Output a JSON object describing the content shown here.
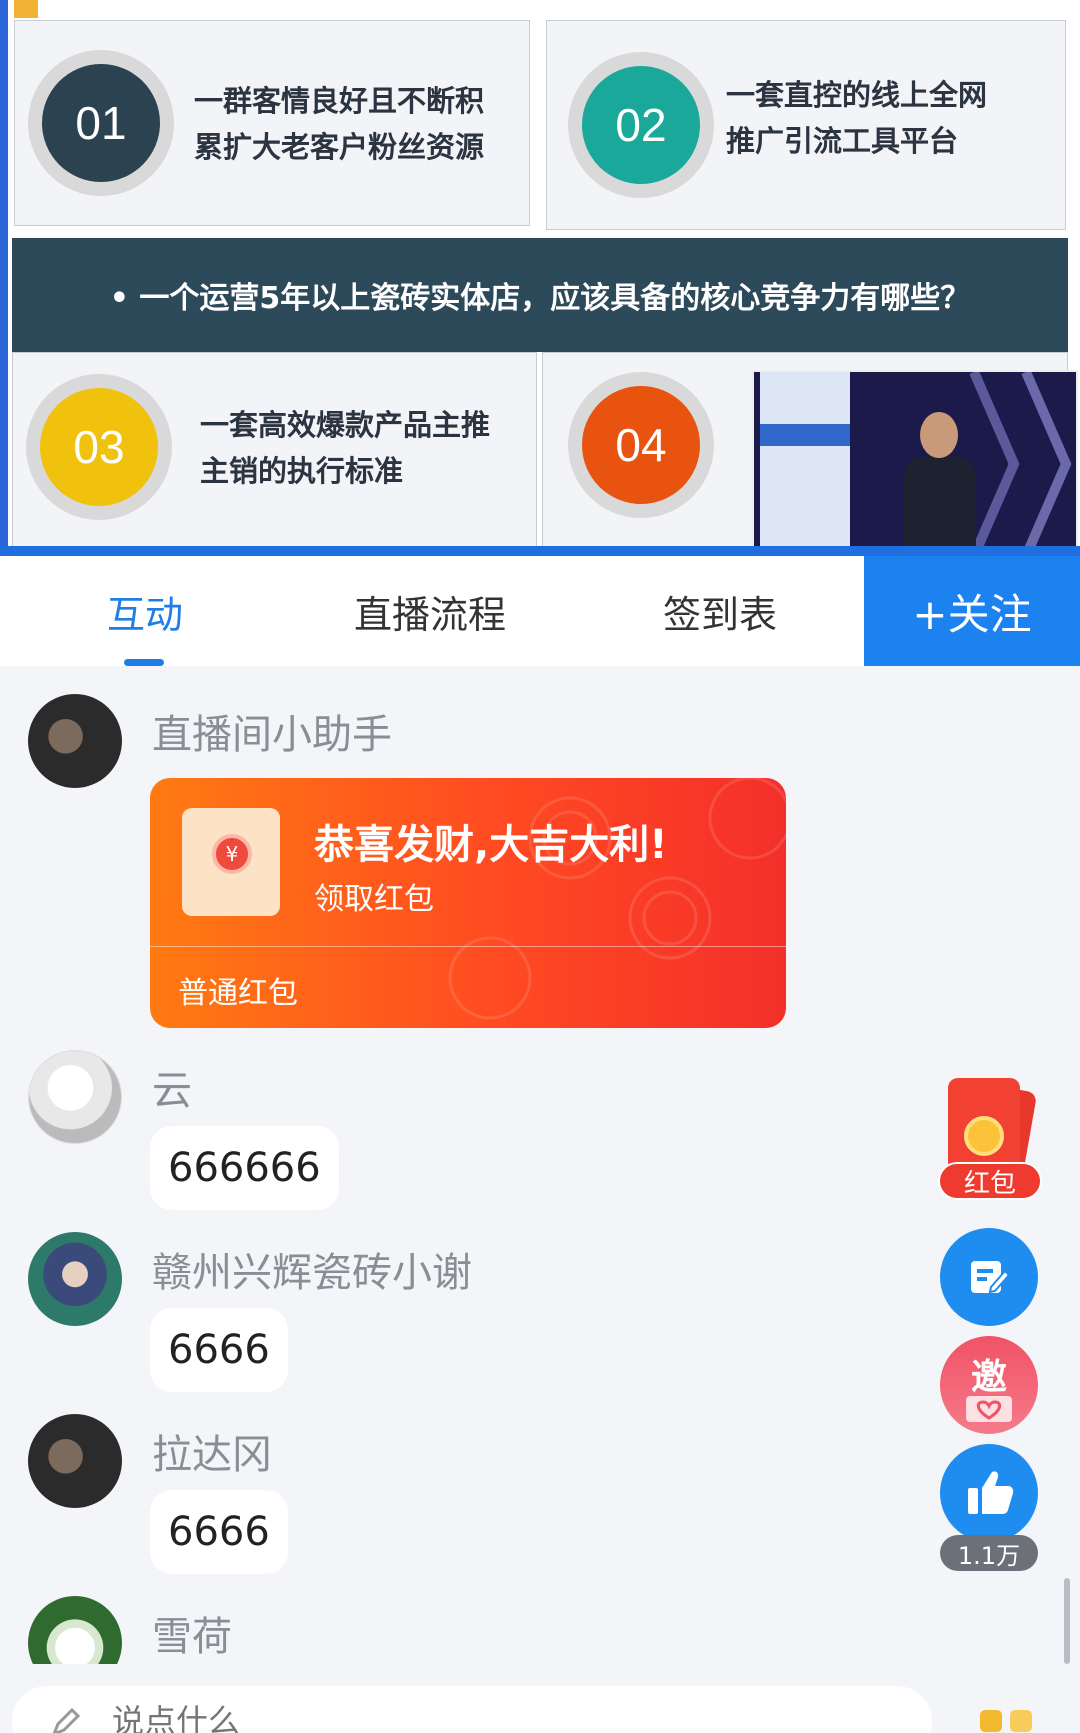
{
  "slide": {
    "cards": [
      {
        "num": "01",
        "line1": "一群客情良好且不断积",
        "line2": "累扩大老客户粉丝资源"
      },
      {
        "num": "02",
        "line1": "一套直控的线上全网",
        "line2": "推广引流工具平台"
      },
      {
        "num": "03",
        "line1": "一套高效爆款产品主推",
        "line2": "主销的执行标准"
      },
      {
        "num": "04"
      }
    ],
    "banner": "• 一个运营5年以上瓷砖实体店，应该具备的核心竞争力有哪些？"
  },
  "tabs": {
    "interact": "互动",
    "flow": "直播流程",
    "signin": "签到表",
    "follow": "+关注"
  },
  "chat": {
    "messages": [
      {
        "user": "直播间小助手"
      },
      {
        "user": "云",
        "text": "666666"
      },
      {
        "user": "赣州兴辉瓷砖小谢",
        "text": "6666"
      },
      {
        "user": "拉达冈",
        "text": "6666"
      },
      {
        "user": "雪荷"
      }
    ],
    "redpacket": {
      "title": "恭喜发财,大吉大利!",
      "action": "领取红包",
      "kind": "普通红包"
    }
  },
  "floating": {
    "redpacket_label": "红包",
    "invite_label": "邀",
    "like_count": "1.1万"
  },
  "input": {
    "placeholder": "说点什么"
  },
  "colors": {
    "accent": "#1b82f0",
    "redpacket": "#ff4a22"
  }
}
